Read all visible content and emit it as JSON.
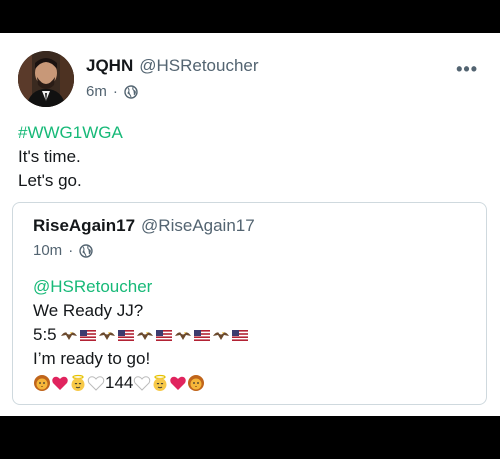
{
  "tweet": {
    "author_name": "JQHN",
    "author_handle": "@HSRetoucher",
    "time": "6m",
    "separator": "·",
    "more_label": "•••",
    "hashtag": "#WWG1WGA",
    "line1": "It's time.",
    "line2": "Let's go."
  },
  "quote": {
    "author_name": "RiseAgain17",
    "author_handle": "@RiseAgain17",
    "time": "10m",
    "separator": "·",
    "mention": "@HSRetoucher",
    "line1": "We Ready JJ?",
    "score_prefix": "5:5",
    "line3": "I’m ready to go!",
    "count_text": "144"
  },
  "icons": {
    "globe": "globe-icon",
    "eagle": "eagle-icon",
    "flag": "us-flag-icon",
    "lion": "lion-icon",
    "heart": "red-heart-icon",
    "angel": "angel-icon",
    "white_heart": "white-heart-icon"
  },
  "colors": {
    "hashtag": "#17b978",
    "text": "#14171a",
    "secondary": "#536471",
    "heart": "#e0245e"
  }
}
